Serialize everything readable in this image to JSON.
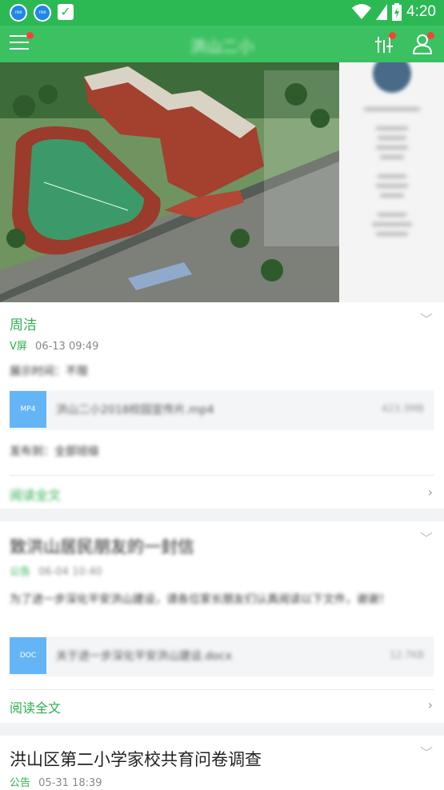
{
  "status_bar": {
    "app_icon_text": "rox",
    "time": "4:20"
  },
  "app_bar": {
    "title": "洪山二小"
  },
  "posts": [
    {
      "author": "周洁",
      "tag": "V屏",
      "date": "06-13 09:49",
      "line1": "展示时间：不限",
      "attachment_icon": "MP4",
      "attachment_name": "洪山二小2018校园宣传片.mp4",
      "attachment_size": "423.3MB",
      "line2": "发布到：全部班级",
      "read_more": "阅读全文"
    },
    {
      "title": "致洪山居民朋友的一封信",
      "tag": "公告",
      "date": "06-04 10:40",
      "body": "为了进一步深化平安洪山建设，请各位家长朋友们认真阅读以下文件，谢谢！",
      "attachment_icon": "DOC",
      "attachment_name": "关于进一步深化平安洪山建设.docx",
      "attachment_size": "12.7KB",
      "read_more": "阅读全文"
    },
    {
      "title": "洪山区第二小学家校共育问卷调查",
      "tag": "公告",
      "date": "05-31 18:39"
    }
  ]
}
